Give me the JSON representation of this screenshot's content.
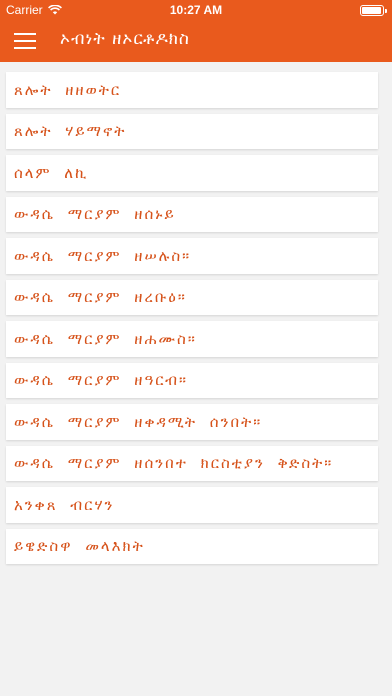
{
  "status_bar": {
    "carrier": "Carrier",
    "time": "10:27 AM"
  },
  "header": {
    "title": "ኦብነት ዘኦርቶዶክስ",
    "menu_icon": "hamburger-menu-icon"
  },
  "colors": {
    "accent": "#e95a1d",
    "item_text": "#d6521a",
    "background": "#f2f2f2"
  },
  "items": [
    {
      "label": "ጸሎት ዘዘወትር"
    },
    {
      "label": "ጸሎት ሃይማኖት"
    },
    {
      "label": "ሰላም ለኪ"
    },
    {
      "label": "ውዳሴ ማርያም ዘሰኑይ"
    },
    {
      "label": "ውዳሴ ማርያም ዘሠሉስ።"
    },
    {
      "label": "ውዳሴ ማርያም ዘረቡዕ።"
    },
    {
      "label": "ውዳሴ ማርያም ዘሐሙስ።"
    },
    {
      "label": "ውዳሴ ማርያም ዘዓርብ።"
    },
    {
      "label": "ውዳሴ ማርያም ዘቀዳሚት ሰንበት።"
    },
    {
      "label": "ውዳሴ ማርያም ዘሰንበተ ክርስቲያን ቅድስት።"
    },
    {
      "label": "አንቀጸ ብርሃን"
    },
    {
      "label": "ይዌድስዋ መላእክት"
    }
  ]
}
